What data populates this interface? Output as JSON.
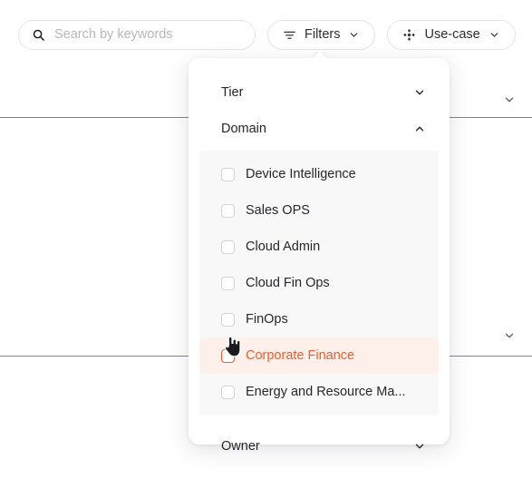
{
  "search": {
    "placeholder": "Search by keywords",
    "value": "",
    "icon": "search-icon"
  },
  "toolbar": {
    "filters_label": "Filters",
    "filters_icon": "filter-lines-icon",
    "usecase_label": "Use-case",
    "usecase_icon": "diamond-cluster-icon",
    "caret_icon": "chevron-down-icon"
  },
  "dropdown": {
    "sections": [
      {
        "label": "Tier",
        "expanded": false,
        "chevron": "chevron-down-icon"
      },
      {
        "label": "Domain",
        "expanded": true,
        "chevron": "chevron-up-icon"
      },
      {
        "label": "Owner",
        "expanded": false,
        "chevron": "chevron-down-icon"
      }
    ],
    "domain_options": [
      {
        "label": "Device Intelligence",
        "checked": false,
        "hovered": false
      },
      {
        "label": "Sales OPS",
        "checked": false,
        "hovered": false
      },
      {
        "label": "Cloud Admin",
        "checked": false,
        "hovered": false
      },
      {
        "label": "Cloud Fin Ops",
        "checked": false,
        "hovered": false
      },
      {
        "label": "FinOps",
        "checked": false,
        "hovered": false
      },
      {
        "label": "Corporate Finance",
        "checked": false,
        "hovered": true
      },
      {
        "label": "Energy and Resource Ma...",
        "checked": false,
        "hovered": false
      }
    ]
  },
  "colors": {
    "accent": "#ef5f2c",
    "accent_bg": "#fdf0ea",
    "text": "#25272d",
    "muted": "#b6b8be",
    "border": "#e3e4e8",
    "list_bg": "#f8f8f9",
    "divider": "#6b6e7d"
  },
  "cursor": {
    "type": "pointer-hand-cursor"
  }
}
